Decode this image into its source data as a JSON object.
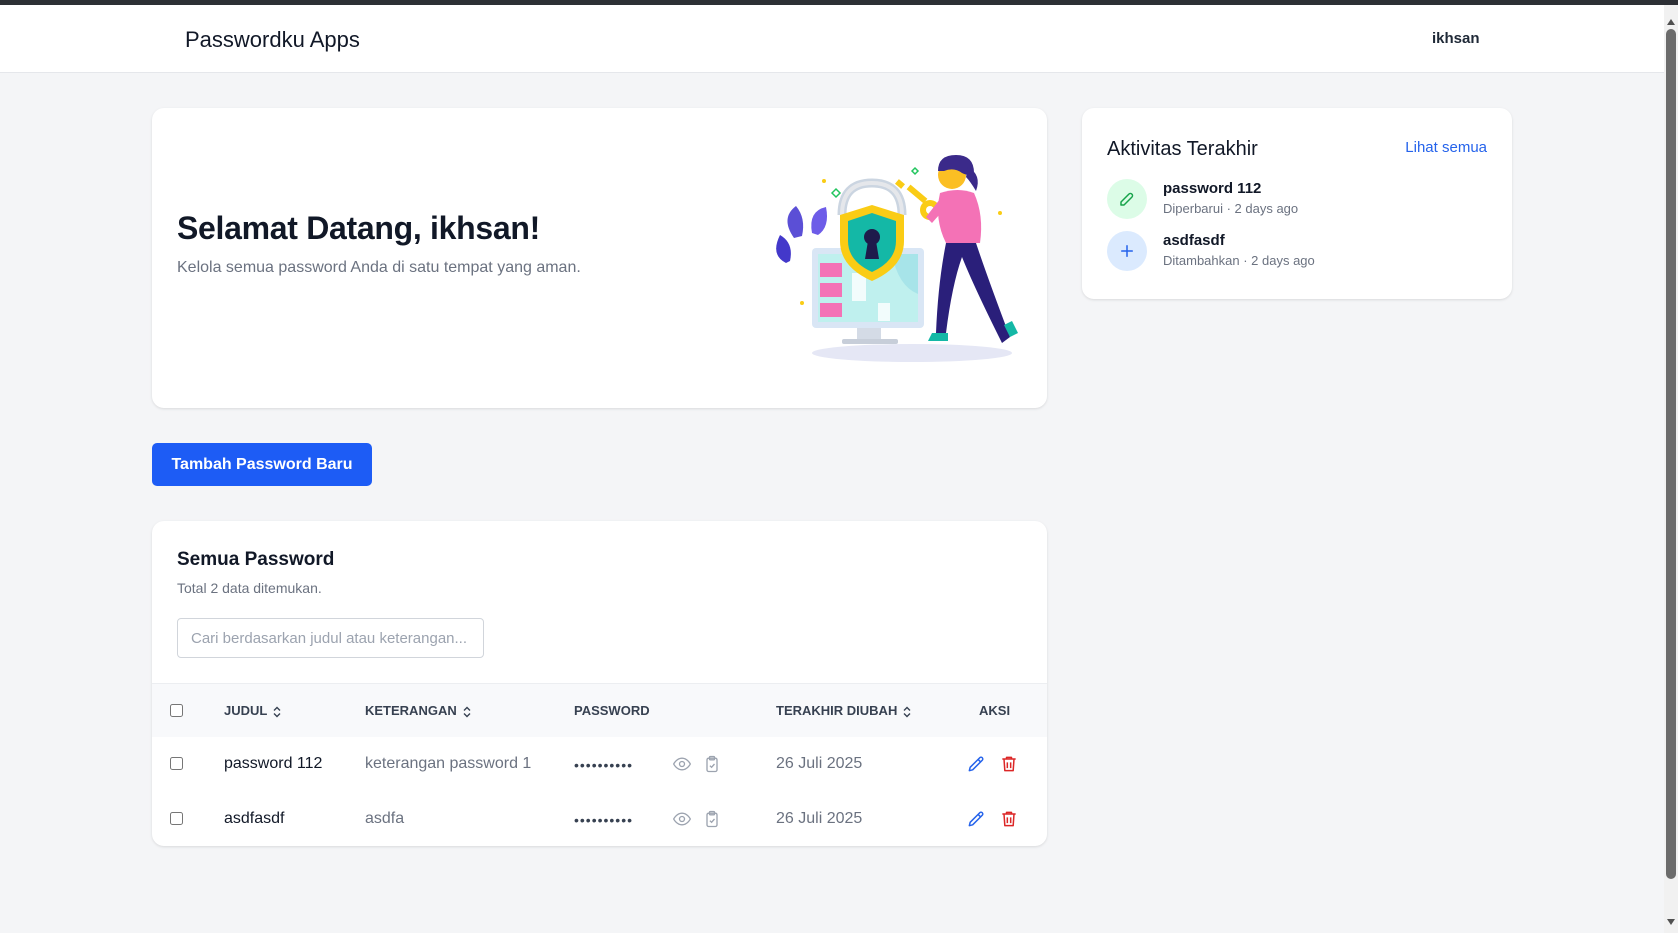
{
  "navbar": {
    "brand": "Passwordku Apps",
    "user": "ikhsan"
  },
  "welcome": {
    "title": "Selamat Datang, ikhsan!",
    "subtitle": "Kelola semua password Anda di satu tempat yang aman."
  },
  "activity": {
    "title": "Aktivitas Terakhir",
    "see_all": "Lihat semua",
    "items": [
      {
        "name": "password 112",
        "meta": "Diperbarui · 2 days ago",
        "icon": "edit-icon",
        "color": "#16a34a"
      },
      {
        "name": "asdfasdf",
        "meta": "Ditambahkan · 2 days ago",
        "icon": "plus-icon",
        "color": "#2563eb"
      }
    ]
  },
  "add_button": "Tambah Password Baru",
  "passwords": {
    "title": "Semua Password",
    "count_text": "Total 2 data ditemukan.",
    "search_placeholder": "Cari berdasarkan judul atau keterangan...",
    "columns": {
      "judul": "JUDUL",
      "keterangan": "KETERANGAN",
      "password": "PASSWORD",
      "updated": "TERAKHIR DIUBAH",
      "actions": "AKSI"
    },
    "rows": [
      {
        "judul": "password 112",
        "keterangan": "keterangan password 1",
        "password_mask": "••••••••••",
        "updated": "26 Juli 2025"
      },
      {
        "judul": "asdfasdf",
        "keterangan": "asdfa",
        "password_mask": "••••••••••",
        "updated": "26 Juli 2025"
      }
    ]
  },
  "colors": {
    "primary": "#1d5cf5",
    "link": "#2563eb",
    "danger": "#dc2626",
    "edit": "#2563eb"
  }
}
